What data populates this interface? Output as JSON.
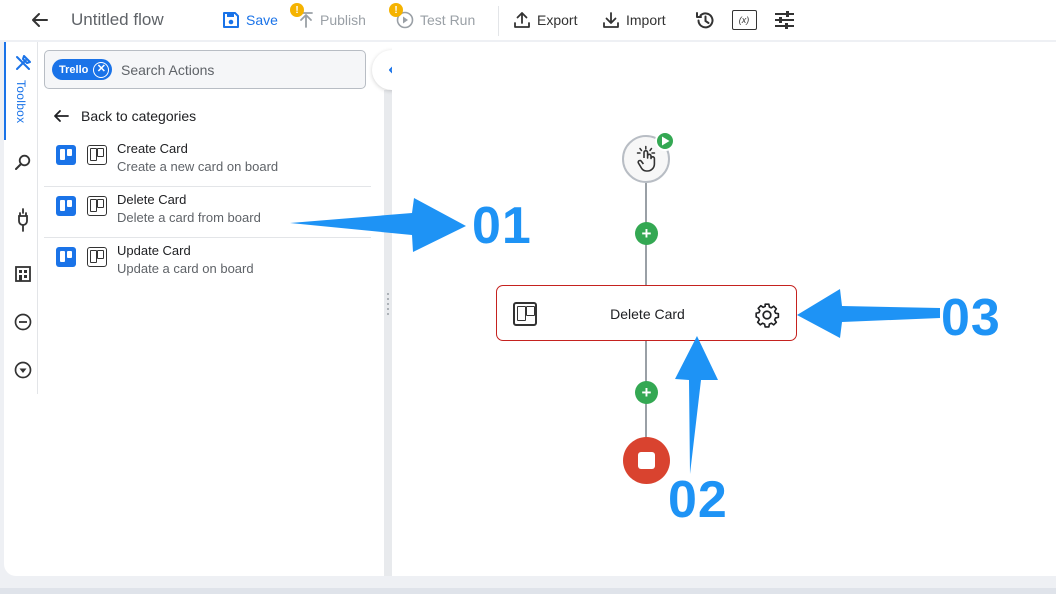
{
  "topbar": {
    "flow_title": "Untitled flow",
    "save_label": "Save",
    "publish_label": "Publish",
    "test_run_label": "Test Run",
    "warning_glyph": "!",
    "export_label": "Export",
    "import_label": "Import",
    "variables_glyph": "(x)"
  },
  "rail": {
    "toolbox_label": "Toolbox"
  },
  "panel": {
    "search_chip": "Trello",
    "chip_close_glyph": "✕",
    "search_placeholder": "Search Actions",
    "back_label": "Back to categories",
    "actions": [
      {
        "title": "Create Card",
        "description": "Create a new card on board"
      },
      {
        "title": "Delete Card",
        "description": "Delete a card from board"
      },
      {
        "title": "Update Card",
        "description": "Update a card on board"
      }
    ]
  },
  "canvas": {
    "step_label": "Delete Card",
    "add_glyph": "+"
  },
  "annotations": {
    "callout_1": "01",
    "callout_2": "02",
    "callout_3": "03",
    "color": "#1e93f5"
  },
  "colors": {
    "accent": "#1a73e8",
    "success": "#34a853",
    "danger": "#d9432f",
    "warning": "#f5b300"
  }
}
